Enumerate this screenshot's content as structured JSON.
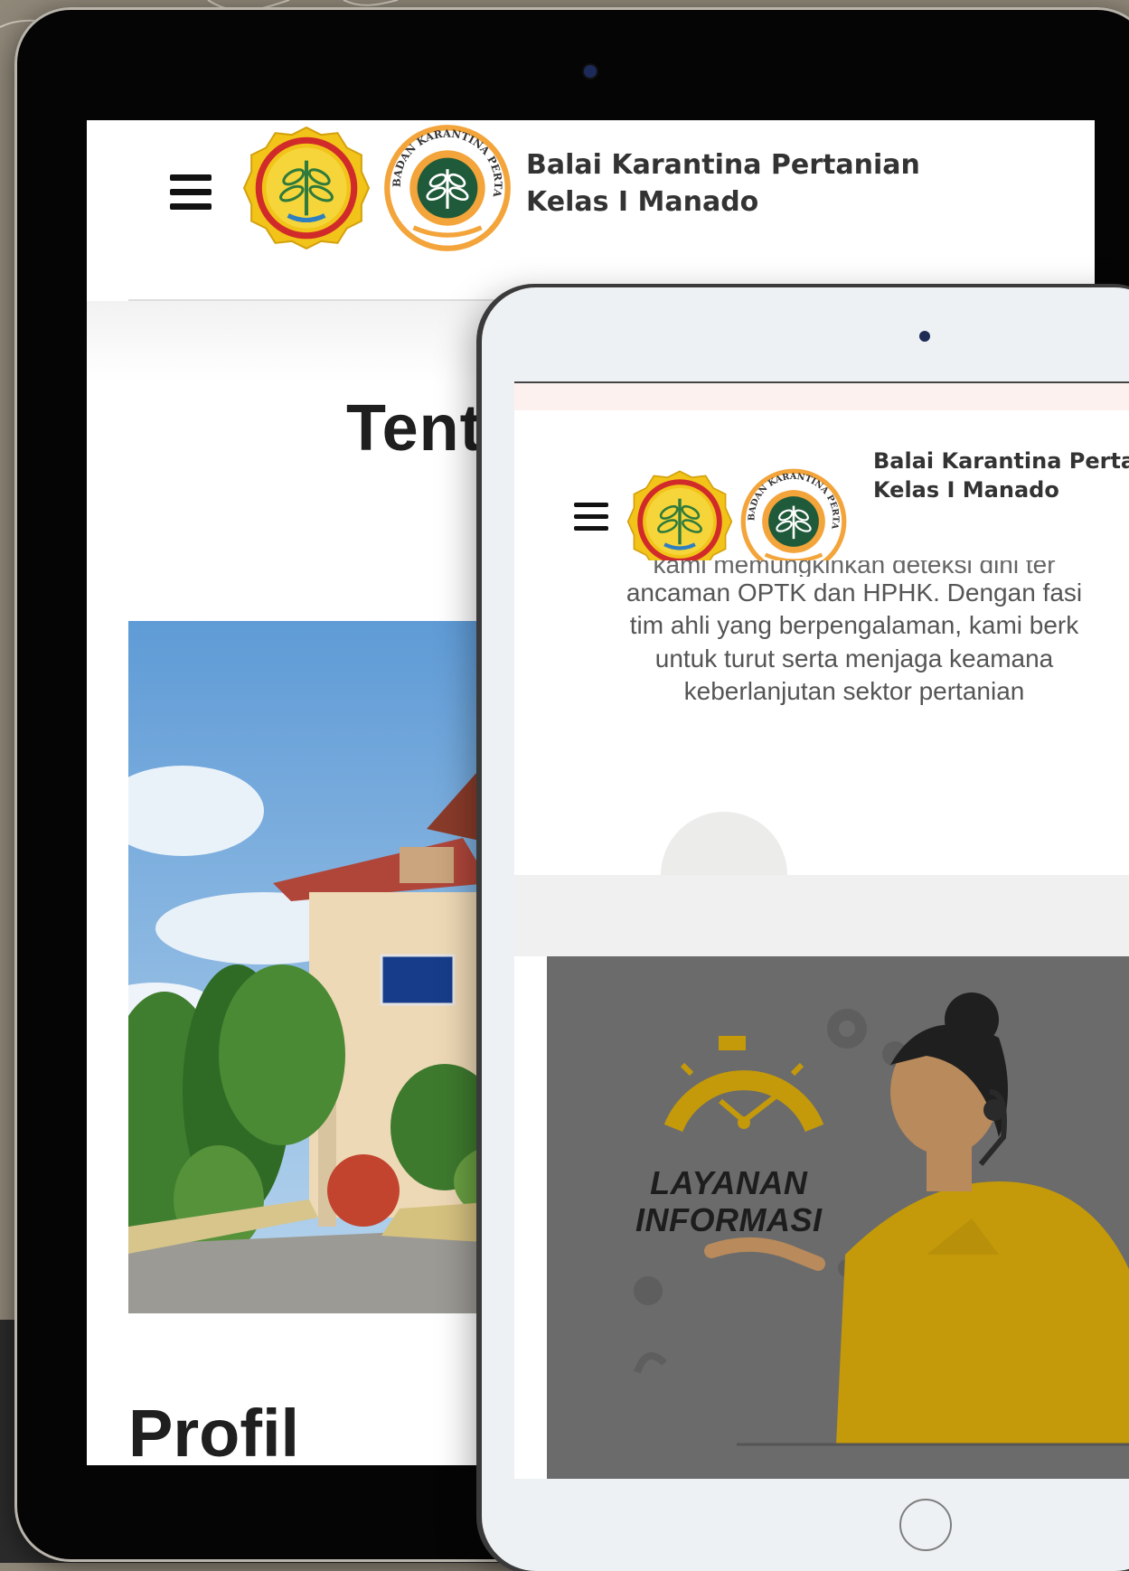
{
  "site": {
    "brand_line1": "Balai Karantina Pertanian",
    "brand_line2": "Kelas I Manado",
    "brand_line1_truncated": "Balai Karantina Pertan",
    "logo_a_name": "kementan-logo",
    "logo_b_name": "badan-karantina-pertanian-logo",
    "logo_b_ring_text": "BADAN KARANTINA PERTANIAN"
  },
  "back_screen": {
    "heading_visible": "Tent",
    "section_title": "Profil"
  },
  "front_screen": {
    "body_lines": [
      "kami memungkinkan deteksi dini ter",
      "ancaman OPTK dan HPHK. Dengan fasi",
      "tim ahli yang berpengalaman, kami berk",
      "untuk turut serta menjaga keamana",
      "keberlanjutan sektor pertanian"
    ],
    "banner_line1": "LAYANAN",
    "banner_line2": "INFORMASI"
  },
  "colors": {
    "logo_yellow": "#f2c318",
    "logo_red": "#d12a2a",
    "logo_green": "#2f7a3c",
    "badge_orange": "#f3a43a",
    "badge_green": "#1f5a3a",
    "banner_gold": "#c49a0a"
  }
}
